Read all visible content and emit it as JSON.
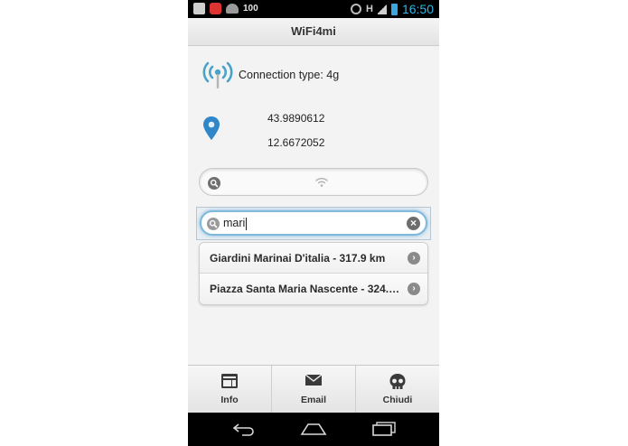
{
  "status_bar": {
    "battery_text": "100",
    "network": "H",
    "time": "16:50",
    "icons": [
      "image-icon",
      "blocked-icon",
      "android-icon",
      "rotate-icon",
      "signal-icon",
      "battery-icon"
    ]
  },
  "app": {
    "title": "WiFi4mi"
  },
  "connection": {
    "label": "Connection type: 4g",
    "icon": "antenna-icon"
  },
  "location": {
    "latitude": "43.9890612",
    "longitude": "12.6672052",
    "icon": "map-pin-icon"
  },
  "search": {
    "value": "",
    "icons": [
      "search-icon",
      "wifi-icon"
    ]
  },
  "filter": {
    "value": "mari",
    "clear_icon": "clear-icon"
  },
  "results": [
    {
      "label": "Giardini Marinai D'italia - 317.9 km"
    },
    {
      "label": "Piazza Santa Maria Nascente - 324.…"
    }
  ],
  "nav": {
    "items": [
      {
        "label": "Info",
        "icon": "info-icon"
      },
      {
        "label": "Email",
        "icon": "email-icon"
      },
      {
        "label": "Chiudi",
        "icon": "skull-icon"
      }
    ]
  },
  "system_bar": {
    "buttons": [
      "back-icon",
      "home-icon",
      "recent-apps-icon"
    ]
  },
  "colors": {
    "accent": "#33b5e5",
    "antenna": "#4aa3c7",
    "pin": "#2f86c8"
  }
}
